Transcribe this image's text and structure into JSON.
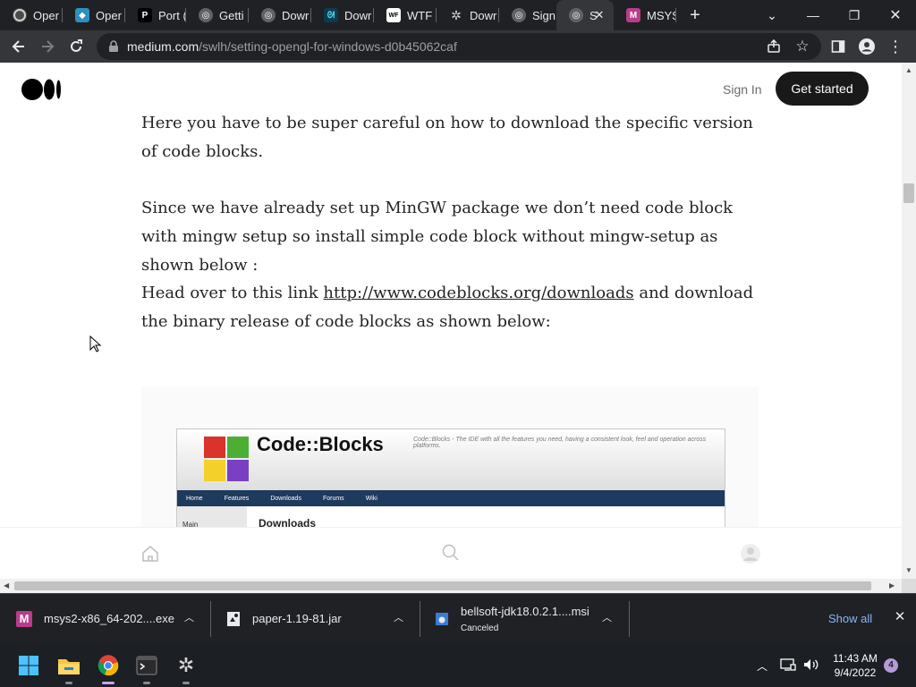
{
  "colors": {
    "chrome_bg": "#202124",
    "toolbar_bg": "#35363a",
    "accent_blue": "#8ab4f8",
    "medium_button": "#191919"
  },
  "tabs": [
    {
      "label": "Oper",
      "icon": "opera-icon"
    },
    {
      "label": "Oper",
      "icon": "shield-icon"
    },
    {
      "label": "Port (",
      "icon": "p-letter-icon"
    },
    {
      "label": "Getti",
      "icon": "globe-icon"
    },
    {
      "label": "Dowr",
      "icon": "globe-icon"
    },
    {
      "label": "Dowr",
      "icon": "ampersand-icon"
    },
    {
      "label": "WTF",
      "icon": "wtf-icon"
    },
    {
      "label": "Dowr",
      "icon": "gear-icon"
    },
    {
      "label": "Sign",
      "icon": "globe-icon"
    },
    {
      "label": "S",
      "icon": "globe-icon",
      "active": true
    },
    {
      "label": "MSYS",
      "icon": "msys-icon"
    }
  ],
  "toolbar": {
    "url_host": "medium.com",
    "url_path": "/swlh/setting-opengl-for-windows-d0b45062caf"
  },
  "medium": {
    "signin": "Sign In",
    "get_started": "Get started"
  },
  "article": {
    "p1": "Here you have to be super careful on how to download the specific version of code blocks.",
    "p2": "Since we have already set up MinGW package we don’t need code block with mingw setup so install simple code block without mingw-setup as shown below :",
    "p3_before": "Head over to this link ",
    "p3_link": "http://www.codeblocks.org/downloads",
    "p3_after": " and download the binary release of code blocks as shown below:"
  },
  "embedded_image": {
    "title": "Code::Blocks",
    "tagline": "Code::Blocks - The IDE with all the features you need, having a consistent look, feel and operation across platforms.",
    "nav": [
      "Home",
      "Features",
      "Downloads",
      "Forums",
      "Wiki"
    ],
    "side_label": "Main",
    "heading": "Downloads"
  },
  "downloads": [
    {
      "name": "msys2-x86_64-202....exe",
      "status": ""
    },
    {
      "name": "paper-1.19-81.jar",
      "status": ""
    },
    {
      "name": "bellsoft-jdk18.0.2.1....msi",
      "status": "Canceled"
    }
  ],
  "shelf": {
    "show_all": "Show all"
  },
  "taskbar": {
    "time": "11:43 AM",
    "date": "9/4/2022",
    "notification_count": "4"
  }
}
